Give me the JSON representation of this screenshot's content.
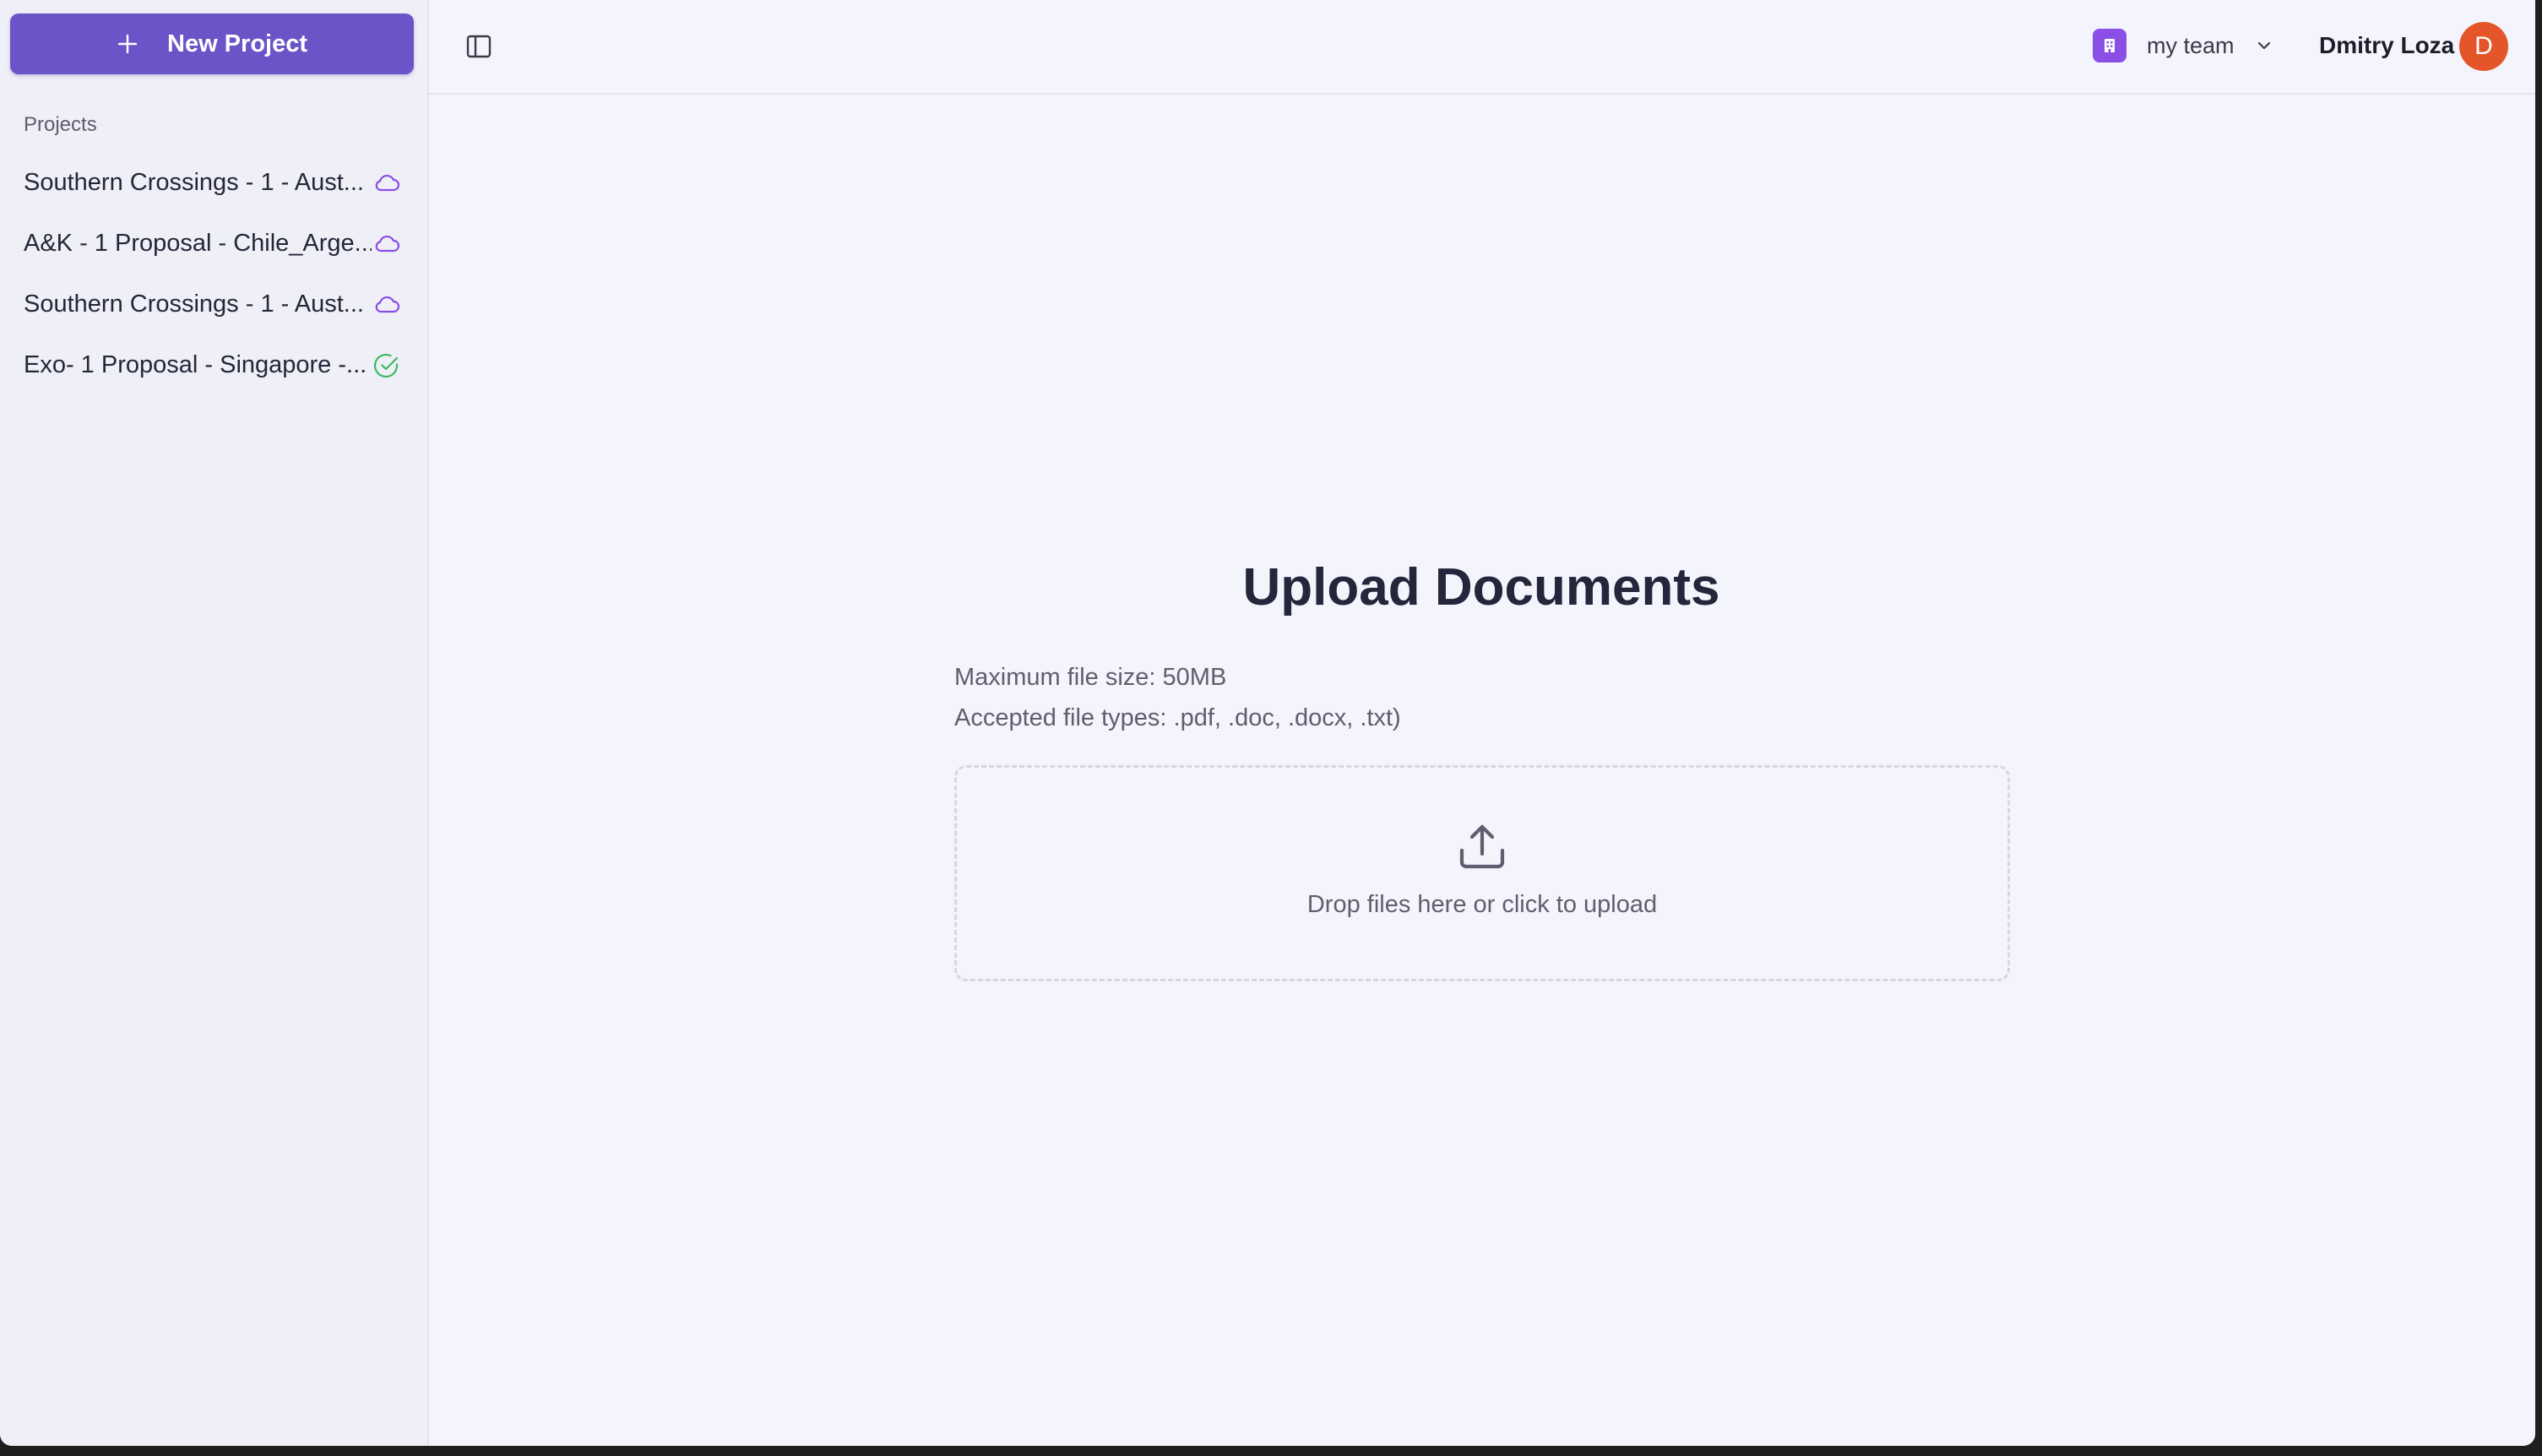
{
  "sidebar": {
    "new_project_label": "New Project",
    "projects_heading": "Projects",
    "projects": [
      {
        "name": "Southern Crossings - 1 - Aust...",
        "status_icon": "cloud-icon"
      },
      {
        "name": "A&K - 1 Proposal - Chile_Arge...",
        "status_icon": "cloud-icon"
      },
      {
        "name": "Southern Crossings - 1 - Aust...",
        "status_icon": "cloud-icon"
      },
      {
        "name": "Exo- 1 Proposal - Singapore -...",
        "status_icon": "check-circle-icon"
      }
    ]
  },
  "header": {
    "team_name": "my team",
    "user_name": "Dmitry Loza",
    "avatar_initial": "D"
  },
  "main": {
    "title": "Upload Documents",
    "max_size": "Maximum file size: 50MB",
    "accepted_types": "Accepted file types: .pdf, .doc, .docx, .txt)",
    "dropzone_text": "Drop files here or click to upload"
  },
  "colors": {
    "primary": "#6a54c8",
    "cloud_status": "#8b4fe6",
    "done_status": "#3cb95c",
    "avatar": "#e4552a",
    "team_badge": "#8b4fe6"
  }
}
